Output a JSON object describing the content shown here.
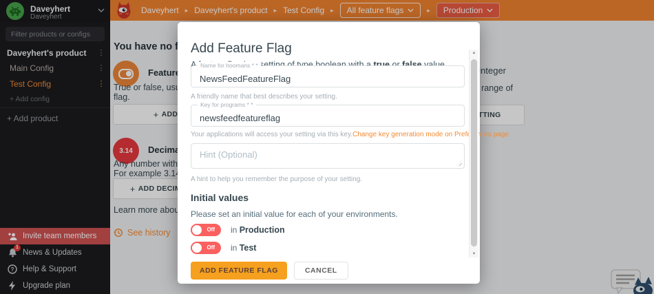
{
  "icons": {
    "kebab": "⋮",
    "plus": "+",
    "caret": "▸",
    "arrow_up": "▲",
    "arrow_down": "▼"
  },
  "sidebar": {
    "org": {
      "name": "Daveyhert",
      "sub": "Daveyhert"
    },
    "filter_placeholder": "Filter products or configs",
    "product": {
      "name": "Daveyhert's product",
      "configs": [
        {
          "label": "Main Config"
        },
        {
          "label": "Test Config"
        }
      ],
      "add_config_label": "+ Add config"
    },
    "add_product_label": "+ Add product",
    "footer_items": [
      {
        "label": "Invite team members"
      },
      {
        "label": "News & Updates",
        "badge": "1"
      },
      {
        "label": "Help & Support"
      },
      {
        "label": "Upgrade plan"
      }
    ]
  },
  "header": {
    "breadcrumb": [
      "Daveyhert",
      "Daveyhert's product",
      "Test Config"
    ],
    "flags_dropdown": "All feature flags",
    "env_dropdown": "Production"
  },
  "content": {
    "heading": "You have no feature flags or settings yet.",
    "cards": [
      {
        "title": "Feature Flag",
        "desc1": "True or false, usually the state of a feature",
        "desc2": "flag.",
        "button": "ADD FEATURE FLAG"
      },
      {
        "icon_text": "3.14",
        "title": "Decimal number",
        "desc1": "Any number within the range of a double.",
        "desc2": "For example 3.14.",
        "button": "ADD DECIMAL NUMBER SETTING"
      },
      {
        "title": "Whole number / integer",
        "desc1": "Any whole number within the range of",
        "button": "ADD WHOLE NUMBER SETTING"
      }
    ],
    "learn_more": "Learn more about Feature Flags and Settings.",
    "see_history": "See history"
  },
  "modal": {
    "title": "Add Feature Flag",
    "subtitle_parts": [
      "A feature flag is a setting of type boolean with a ",
      "true",
      " or ",
      "false",
      " value."
    ],
    "name_field": {
      "label": "Name for hoomans * *",
      "value": "NewsFeedFeatureFlag",
      "helper": "A friendly name that best describes your setting."
    },
    "key_field": {
      "label": "Key for programs * *",
      "value": "newsfeedfeatureflag",
      "helper": "Your applications will access your setting via this key.",
      "helper_link": "Change key generation mode on Preferences page."
    },
    "hint_field": {
      "placeholder": "Hint (Optional)",
      "helper": "A hint to help you remember the purpose of your setting."
    },
    "initial_values": {
      "heading": "Initial values",
      "subtitle": "Please set an initial value for each of your environments.",
      "toggles": [
        {
          "state": "Off",
          "prefix": "in",
          "env": "Production"
        },
        {
          "state": "Off",
          "prefix": "in",
          "env": "Test"
        }
      ]
    },
    "submit": "ADD FEATURE FLAG",
    "cancel": "CANCEL"
  },
  "colors": {
    "header_orange": "#EF8230",
    "accent_orange": "#F28B33",
    "env_red": "#E85C43",
    "toggle_red": "#FA6060",
    "submit_amber": "#F5A01E",
    "invite_red": "#CE5151",
    "flag_icon_orange": "#EA8438",
    "decimal_icon_red": "#E5383E"
  }
}
